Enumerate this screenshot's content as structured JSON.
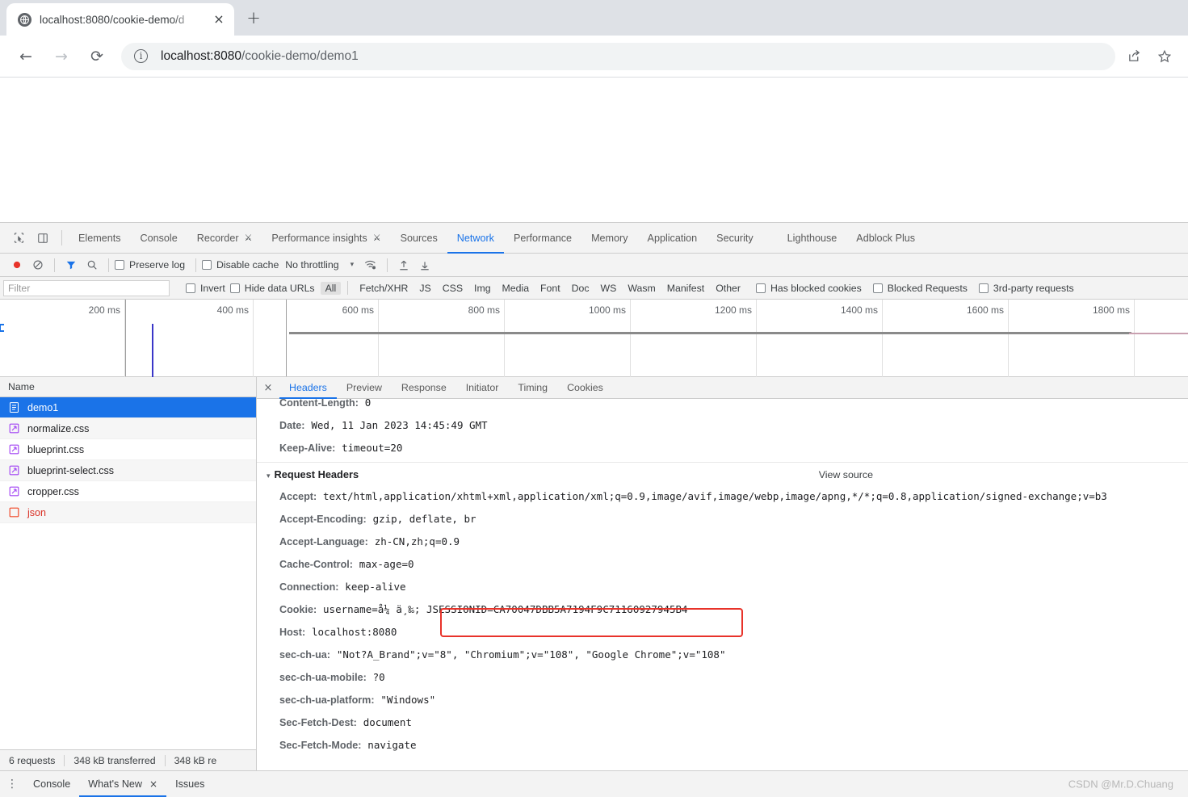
{
  "browser": {
    "tab": {
      "title": "localhost:8080/cookie-demo/d",
      "favicon": "globe-icon",
      "close": "×"
    },
    "new_tab": "+",
    "nav": {
      "back": "←",
      "forward": "→",
      "reload": "⟳"
    },
    "omnibox": {
      "info": "i",
      "host": "localhost:8080",
      "path": "/cookie-demo/demo1"
    },
    "actions": {
      "share": "share-icon",
      "bookmark": "star-icon"
    }
  },
  "devtools": {
    "tabs": [
      {
        "label": "Elements",
        "active": false,
        "warn": false
      },
      {
        "label": "Console",
        "active": false,
        "warn": false
      },
      {
        "label": "Recorder",
        "active": false,
        "warn": true
      },
      {
        "label": "Performance insights",
        "active": false,
        "warn": true
      },
      {
        "label": "Sources",
        "active": false,
        "warn": false
      },
      {
        "label": "Network",
        "active": true,
        "warn": false
      },
      {
        "label": "Performance",
        "active": false,
        "warn": false
      },
      {
        "label": "Memory",
        "active": false,
        "warn": false
      },
      {
        "label": "Application",
        "active": false,
        "warn": false
      },
      {
        "label": "Security",
        "active": false,
        "warn": false
      },
      {
        "label": "Lighthouse",
        "active": false,
        "warn": false
      },
      {
        "label": "Adblock Plus",
        "active": false,
        "warn": false
      }
    ],
    "toolbar": {
      "record_tooltip": "record-button",
      "clear_tooltip": "clear-button",
      "filter_tooltip": "filter-button",
      "search_tooltip": "search-button",
      "preserve_log": "Preserve log",
      "disable_cache": "Disable cache",
      "throttling": "No throttling",
      "throttle_caret": "▾",
      "wifi_tooltip": "network-conditions-icon",
      "import_tooltip": "import-har-icon",
      "export_tooltip": "export-har-icon"
    },
    "filterbar": {
      "filter_placeholder": "Filter",
      "invert": "Invert",
      "hide_data_urls": "Hide data URLs",
      "types": [
        "All",
        "Fetch/XHR",
        "JS",
        "CSS",
        "Img",
        "Media",
        "Font",
        "Doc",
        "WS",
        "Wasm",
        "Manifest",
        "Other"
      ],
      "selected_type": "All",
      "has_blocked_cookies": "Has blocked cookies",
      "blocked_requests": "Blocked Requests",
      "third_party": "3rd-party requests"
    },
    "overview": {
      "ticks": [
        "200 ms",
        "400 ms",
        "600 ms",
        "800 ms",
        "1000 ms",
        "1200 ms",
        "1400 ms",
        "1600 ms",
        "1800 ms"
      ]
    },
    "requests": {
      "column_header": "Name",
      "rows": [
        {
          "name": "demo1",
          "icon": "document-icon",
          "selected": true,
          "kind": "doc"
        },
        {
          "name": "normalize.css",
          "icon": "stylesheet-icon",
          "selected": false,
          "kind": "css"
        },
        {
          "name": "blueprint.css",
          "icon": "stylesheet-icon",
          "selected": false,
          "kind": "css"
        },
        {
          "name": "blueprint-select.css",
          "icon": "stylesheet-icon",
          "selected": false,
          "kind": "css"
        },
        {
          "name": "cropper.css",
          "icon": "stylesheet-icon",
          "selected": false,
          "kind": "css"
        },
        {
          "name": "json",
          "icon": "error-icon",
          "selected": false,
          "kind": "json"
        }
      ],
      "footer": [
        "6 requests",
        "348 kB transferred",
        "348 kB re"
      ]
    },
    "detail": {
      "close": "×",
      "tabs": [
        {
          "label": "Headers",
          "active": true
        },
        {
          "label": "Preview",
          "active": false
        },
        {
          "label": "Response",
          "active": false
        },
        {
          "label": "Initiator",
          "active": false
        },
        {
          "label": "Timing",
          "active": false
        },
        {
          "label": "Cookies",
          "active": false
        }
      ],
      "response_headers_visible": [
        {
          "key": "Content-Length:",
          "value": "0"
        },
        {
          "key": "Date:",
          "value": "Wed, 11 Jan 2023 14:45:49 GMT"
        },
        {
          "key": "Keep-Alive:",
          "value": "timeout=20"
        }
      ],
      "request_headers_title": "Request Headers",
      "request_headers_triangle": "▾",
      "view_source": "View source",
      "request_headers": [
        {
          "key": "Accept:",
          "value": "text/html,application/xhtml+xml,application/xml;q=0.9,image/avif,image/webp,image/apng,*/*;q=0.8,application/signed-exchange;v=b3"
        },
        {
          "key": "Accept-Encoding:",
          "value": "gzip, deflate, br"
        },
        {
          "key": "Accept-Language:",
          "value": "zh-CN,zh;q=0.9"
        },
        {
          "key": "Cache-Control:",
          "value": "max-age=0"
        },
        {
          "key": "Connection:",
          "value": "keep-alive"
        },
        {
          "key": "Cookie:",
          "value": "username=å¼ ä¸‰; JSESSIONID=CA70047DBB5A7194F9C71160927945B4"
        },
        {
          "key": "Host:",
          "value": "localhost:8080"
        },
        {
          "key": "sec-ch-ua:",
          "value": "\"Not?A_Brand\";v=\"8\", \"Chromium\";v=\"108\", \"Google Chrome\";v=\"108\""
        },
        {
          "key": "sec-ch-ua-mobile:",
          "value": "?0"
        },
        {
          "key": "sec-ch-ua-platform:",
          "value": "\"Windows\""
        },
        {
          "key": "Sec-Fetch-Dest:",
          "value": "document"
        },
        {
          "key": "Sec-Fetch-Mode:",
          "value": "navigate"
        }
      ],
      "highlight": {
        "name": "jsessionid-highlight",
        "color": "#e8332a",
        "text": "JSESSIONID=CA70047DBB5A7194F9C71160927945B4"
      }
    },
    "drawer": {
      "menu": "⋮",
      "tabs": [
        {
          "label": "Console",
          "active": false,
          "closable": false
        },
        {
          "label": "What's New",
          "active": true,
          "closable": true
        },
        {
          "label": "Issues",
          "active": false,
          "closable": false
        }
      ],
      "close_glyph": "×"
    }
  },
  "watermark": "CSDN @Mr.D.Chuang",
  "colors": {
    "accent": "#1a73e8",
    "record": "#e8332a",
    "highlight": "#e8332a",
    "error": "#d93025",
    "css_icon": "#a142f4"
  }
}
